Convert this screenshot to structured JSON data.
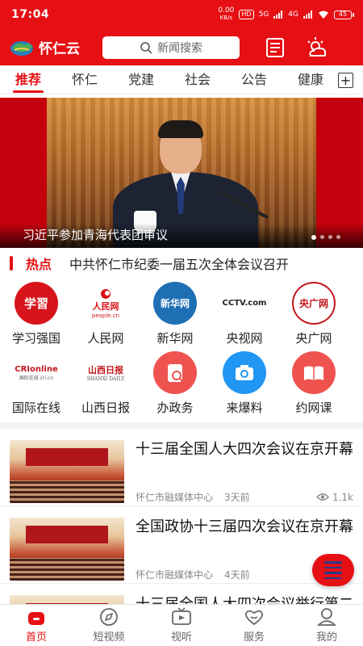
{
  "status_bar": {
    "time": "17:04",
    "net_speed": "0.00",
    "net_unit": "KB/s",
    "hd_badge": "HD",
    "signal1": "5G",
    "signal2": "4G",
    "battery": "45"
  },
  "header": {
    "brand": "怀仁云",
    "search_placeholder": "新闻搜索",
    "icons": [
      "newspaper-icon",
      "weather-icon"
    ]
  },
  "tabs": [
    {
      "label": "推荐",
      "active": true
    },
    {
      "label": "怀仁",
      "active": false
    },
    {
      "label": "党建",
      "active": false
    },
    {
      "label": "社会",
      "active": false
    },
    {
      "label": "公告",
      "active": false
    },
    {
      "label": "健康",
      "active": false
    }
  ],
  "banner": {
    "caption": "习近平参加青海代表团审议",
    "page_count": 4,
    "active_page": 1
  },
  "hot": {
    "label": "热点",
    "headline": "中共怀仁市纪委一届五次全体会议召开"
  },
  "services": [
    {
      "label": "学习强国",
      "icon": "xuexi-icon",
      "logo_text": "学習",
      "color": "#d7141a"
    },
    {
      "label": "人民网",
      "icon": "people-icon",
      "logo_text": "人民网",
      "sub_text": "people.cn",
      "color": "#d7141a"
    },
    {
      "label": "新华网",
      "icon": "xinhua-icon",
      "logo_text": "新华网",
      "color": "#1f6fb5"
    },
    {
      "label": "央视网",
      "icon": "cctv-icon",
      "logo_text": "CCTV.com",
      "color": "#222222"
    },
    {
      "label": "央广网",
      "icon": "cnr-icon",
      "logo_text": "央广网",
      "color": "#c4161c"
    },
    {
      "label": "国际在线",
      "icon": "cri-icon",
      "logo_text": "CRIonline",
      "sub_text": "国际在线 cri.cn",
      "color": "#c4161c"
    },
    {
      "label": "山西日报",
      "icon": "shanxi-daily-icon",
      "logo_text": "山西日报",
      "sub_text": "SHANXI DAILY",
      "color": "#c4161c"
    },
    {
      "label": "办政务",
      "icon": "government-affairs-icon",
      "color": "#ef5350"
    },
    {
      "label": "来爆料",
      "icon": "camera-icon",
      "color": "#2196f3"
    },
    {
      "label": "约网课",
      "icon": "book-icon",
      "color": "#ef5350"
    }
  ],
  "news": [
    {
      "title": "十三届全国人大四次会议在京开幕",
      "source": "怀仁市融媒体中心",
      "date": "3天前",
      "views": "1.1k"
    },
    {
      "title": "全国政协十三届四次会议在京开幕",
      "source": "怀仁市融媒体中心",
      "date": "4天前",
      "views": ""
    },
    {
      "title": "十三届全国人大四次会议举行第二次全体会议",
      "source": "",
      "date": "",
      "views": ""
    }
  ],
  "bottom_nav": [
    {
      "label": "首页",
      "icon": "home-icon",
      "active": true
    },
    {
      "label": "短视频",
      "icon": "compass-icon",
      "active": false
    },
    {
      "label": "视听",
      "icon": "tv-icon",
      "active": false
    },
    {
      "label": "服务",
      "icon": "heart-icon",
      "active": false
    },
    {
      "label": "我的",
      "icon": "profile-icon",
      "active": false
    }
  ],
  "colors": {
    "brand_red": "#e60f13",
    "fab_lines": "#2b3a8a"
  }
}
